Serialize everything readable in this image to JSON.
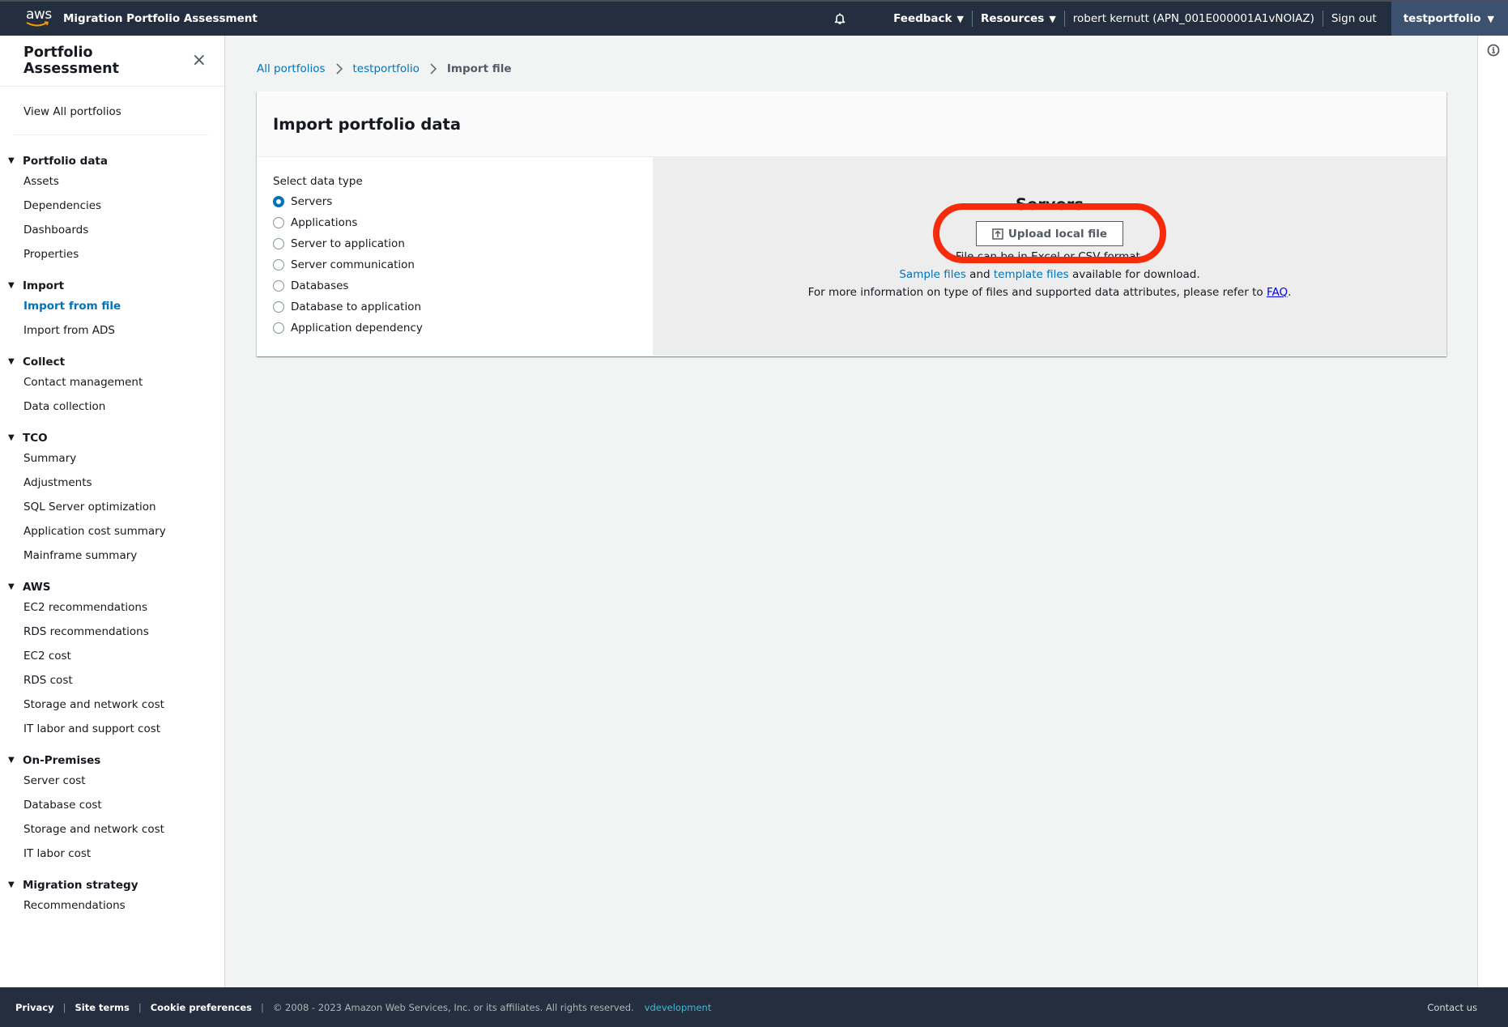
{
  "topbar": {
    "logo_text": "aws",
    "app_title": "Migration Portfolio Assessment",
    "notifications_icon": "bell-icon",
    "feedback_label": "Feedback",
    "resources_label": "Resources",
    "user_label": "robert kernutt (APN_001E000001A1vNOIAZ)",
    "signout_label": "Sign out",
    "portfolio_label": "testportfolio",
    "caret": "▼"
  },
  "sidebar": {
    "title": "Portfolio Assessment",
    "close_icon": "×",
    "view_all_label": "View All portfolios",
    "caret": "▼",
    "sections": [
      {
        "label": "Portfolio data",
        "items": [
          {
            "label": "Assets"
          },
          {
            "label": "Dependencies"
          },
          {
            "label": "Dashboards"
          },
          {
            "label": "Properties"
          }
        ]
      },
      {
        "label": "Import",
        "items": [
          {
            "label": "Import from file",
            "active": true
          },
          {
            "label": "Import from ADS"
          }
        ]
      },
      {
        "label": "Collect",
        "items": [
          {
            "label": "Contact management"
          },
          {
            "label": "Data collection"
          }
        ]
      },
      {
        "label": "TCO",
        "items": [
          {
            "label": "Summary"
          },
          {
            "label": "Adjustments"
          },
          {
            "label": "SQL Server optimization"
          },
          {
            "label": "Application cost summary"
          },
          {
            "label": "Mainframe summary"
          }
        ]
      },
      {
        "label": "AWS",
        "items": [
          {
            "label": "EC2 recommendations"
          },
          {
            "label": "RDS recommendations"
          },
          {
            "label": "EC2 cost"
          },
          {
            "label": "RDS cost"
          },
          {
            "label": "Storage and network cost"
          },
          {
            "label": "IT labor and support cost"
          }
        ]
      },
      {
        "label": "On-Premises",
        "items": [
          {
            "label": "Server cost"
          },
          {
            "label": "Database cost"
          },
          {
            "label": "Storage and network cost"
          },
          {
            "label": "IT labor cost"
          }
        ]
      },
      {
        "label": "Migration strategy",
        "items": [
          {
            "label": "Recommendations"
          }
        ]
      }
    ]
  },
  "breadcrumb": {
    "items": [
      {
        "label": "All portfolios"
      },
      {
        "label": "testportfolio"
      }
    ],
    "current": "Import file"
  },
  "panel": {
    "title": "Import portfolio data",
    "select_label": "Select data type",
    "options": [
      {
        "label": "Servers",
        "checked": true
      },
      {
        "label": "Applications",
        "checked": false
      },
      {
        "label": "Server to application",
        "checked": false
      },
      {
        "label": "Server communication",
        "checked": false
      },
      {
        "label": "Databases",
        "checked": false
      },
      {
        "label": "Database to application",
        "checked": false
      },
      {
        "label": "Application dependency",
        "checked": false
      }
    ],
    "selected_title": "Servers",
    "upload_label": "Upload local file",
    "format_hint": "File can be in Excel or CSV format.",
    "sample_link": "Sample files",
    "and_text": " and ",
    "template_link": "template files",
    "download_text": " available for download.",
    "faq_prefix": "For more information on type of files and supported data attributes, please refer to ",
    "faq_link": "FAQ",
    "faq_suffix": "."
  },
  "footer": {
    "privacy": "Privacy",
    "site_terms": "Site terms",
    "cookie_prefs": "Cookie preferences",
    "sep": "|",
    "copyright": "© 2008 - 2023 Amazon Web Services, Inc. or its affiliates. All rights reserved.",
    "environment": "vdevelopment",
    "contact": "Contact us"
  },
  "colors": {
    "accent": "#0073bb",
    "header_bg": "#232f3e",
    "highlight": "#f82a0c"
  }
}
